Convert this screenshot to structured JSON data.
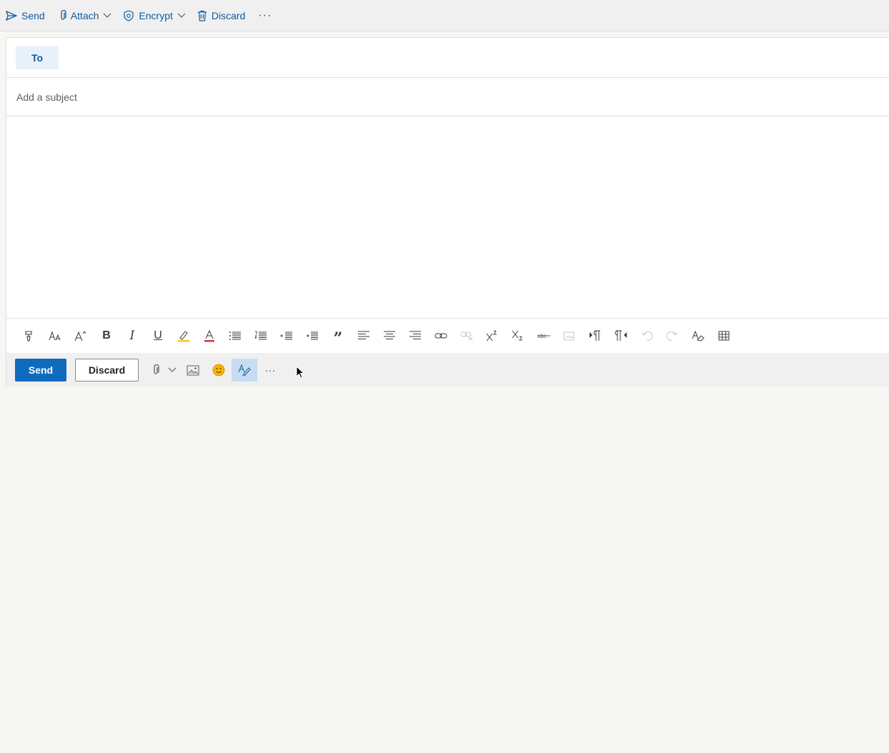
{
  "topbar": {
    "send_label": "Send",
    "attach_label": "Attach",
    "encrypt_label": "Encrypt",
    "discard_label": "Discard",
    "more_label": "···"
  },
  "compose": {
    "to_label": "To",
    "to_value": "",
    "subject_placeholder": "Add a subject",
    "subject_value": ""
  },
  "format_toolbar": {
    "italic_glyph": "I",
    "underline_glyph": "U",
    "quote_glyph": "”",
    "bold_glyph": "B"
  },
  "actions": {
    "send_label": "Send",
    "discard_label": "Discard",
    "more_label": "···"
  },
  "colors": {
    "accent": "#0f6cbd",
    "link": "#0f5a9c",
    "highlight": "#f2c811",
    "font_color": "#d13438"
  }
}
